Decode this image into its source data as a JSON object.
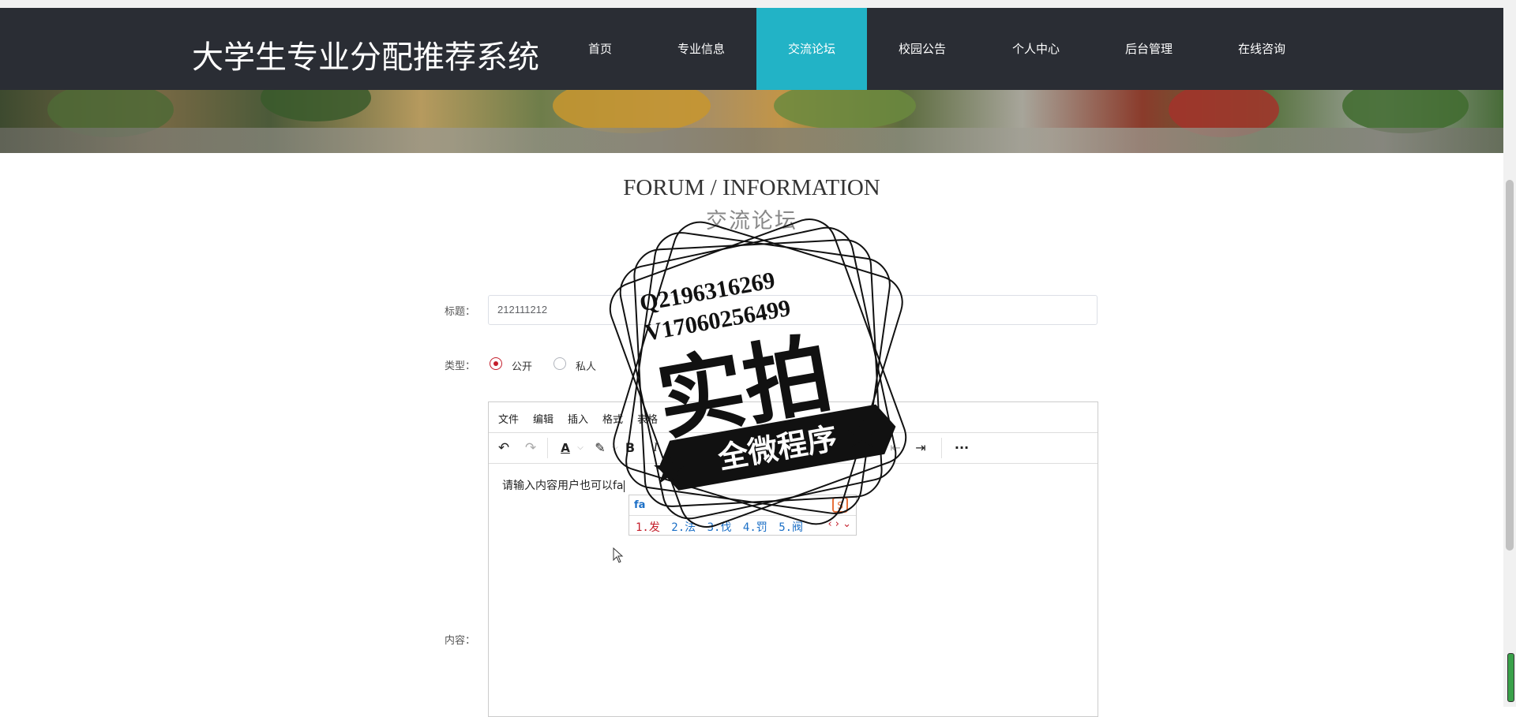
{
  "site_title": "大学生专业分配推荐系统",
  "nav": [
    {
      "label": "首页"
    },
    {
      "label": "专业信息"
    },
    {
      "label": "交流论坛",
      "active": true
    },
    {
      "label": "校园公告"
    },
    {
      "label": "个人中心"
    },
    {
      "label": "后台管理"
    },
    {
      "label": "在线咨询"
    }
  ],
  "section": {
    "title_en": "FORUM / INFORMATION",
    "title_zh": "交流论坛"
  },
  "form": {
    "title_label": "标题：",
    "title_value": "212111212",
    "type_label": "类型：",
    "type_options": [
      {
        "label": "公开",
        "checked": true
      },
      {
        "label": "私人",
        "checked": false
      }
    ],
    "content_label": "内容："
  },
  "editor": {
    "menus": [
      "文件",
      "编辑",
      "插入",
      "格式",
      "表格"
    ],
    "content_text": "请输入内容用户也可以fa",
    "toolbar_icons": [
      "undo-icon",
      "redo-icon",
      "text-color-icon",
      "highlight-icon",
      "bold-icon",
      "italic-icon",
      "strikethrough-icon",
      "align-justify-icon",
      "outdent-icon",
      "indent-icon",
      "more-icon"
    ]
  },
  "ime": {
    "composition": "fa",
    "candidates": [
      "1.发",
      "2.法",
      "3.伐",
      "4.罚",
      "5.阀"
    ]
  },
  "stamp": {
    "line1": "Q2196316269",
    "line2": "V17060256499",
    "big_text": "实拍",
    "ribbon_text": "全微程序"
  },
  "colors": {
    "nav_bg": "#2a2d34",
    "nav_active": "#22b3c6",
    "radio_checked": "#c41e2b"
  }
}
